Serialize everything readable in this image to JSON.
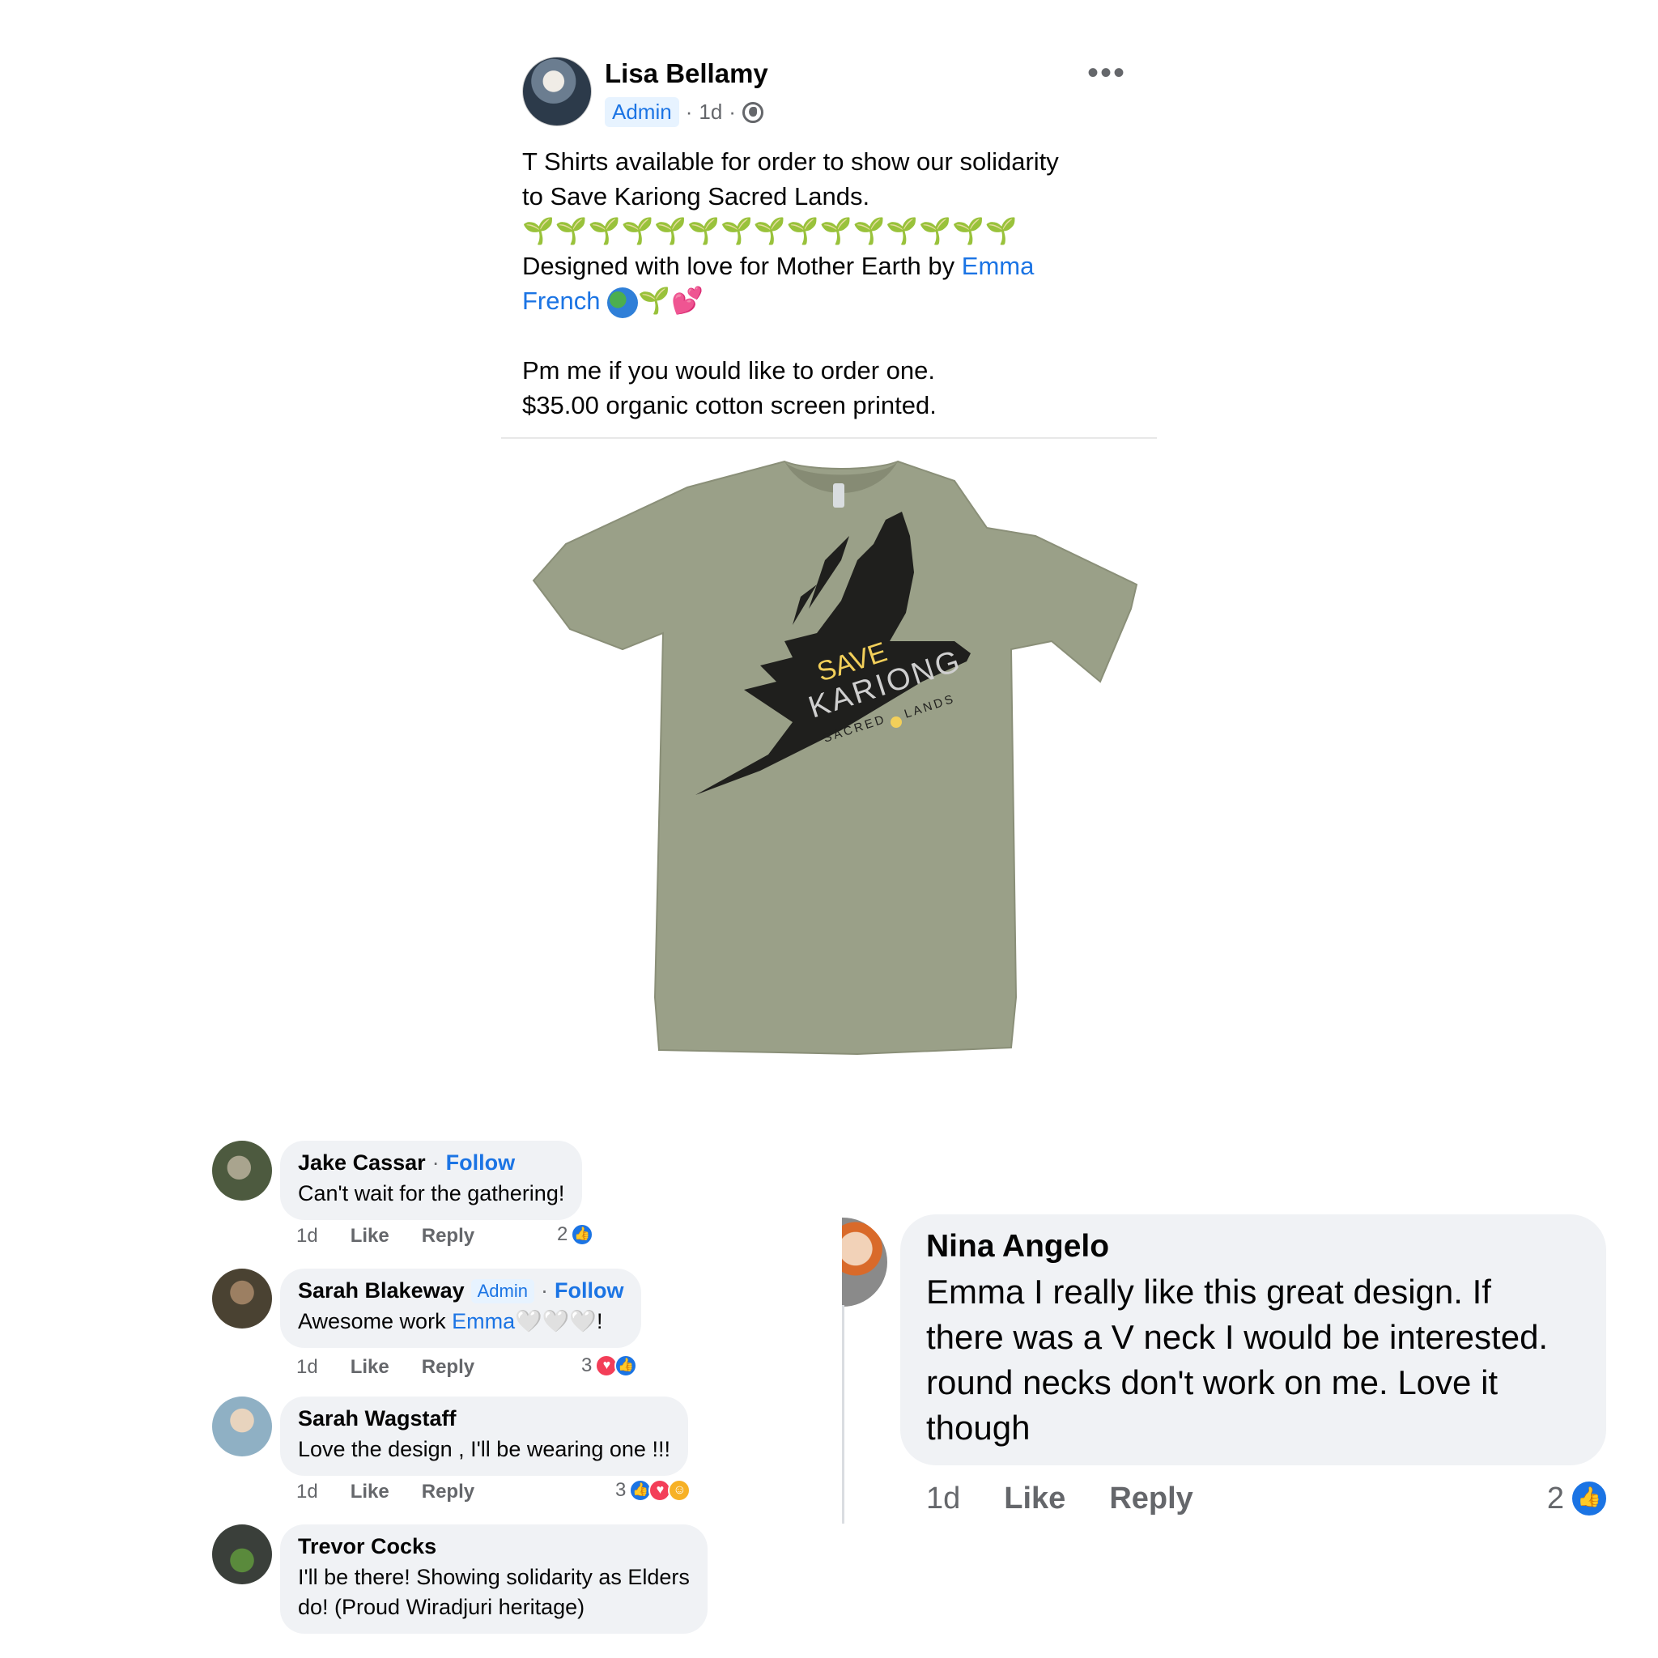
{
  "post": {
    "author": "Lisa Bellamy",
    "badge": "Admin",
    "time": "1d",
    "line1": "T Shirts available for order to show our solidarity",
    "line2": "to Save Kariong Sacred Lands.",
    "sprouts": "🌱🌱🌱🌱🌱🌱🌱🌱🌱🌱🌱🌱🌱🌱🌱",
    "line3_prefix": "Designed with love for Mother Earth by ",
    "line3_link1": "Emma",
    "line4_link2": "French",
    "line5": "Pm me if you would like to order one.",
    "line6": "$35.00 organic cotton screen printed."
  },
  "shirt": {
    "save": "SAVE",
    "kariong": "KARIONG",
    "sacred": "SACRED",
    "lands": "LANDS",
    "shirt_color": "#9aa088",
    "bird_color": "#1f1f1d",
    "accent_color": "#f2cf5a"
  },
  "comments": [
    {
      "name": "Jake Cassar",
      "follow": "Follow",
      "text": "Can't wait for the gathering!",
      "time": "1d",
      "like": "Like",
      "reply": "Reply",
      "count": "2"
    },
    {
      "name": "Sarah Blakeway",
      "badge": "Admin",
      "follow": "Follow",
      "text_prefix": "Awesome work ",
      "text_link": "Emma",
      "text_suffix": "🤍🤍🤍!",
      "time": "1d",
      "like": "Like",
      "reply": "Reply",
      "count": "3"
    },
    {
      "name": "Sarah Wagstaff",
      "text": "Love the design , I'll be wearing one !!!",
      "time": "1d",
      "like": "Like",
      "reply": "Reply",
      "count": "3"
    },
    {
      "name": "Trevor Cocks",
      "text_line1": "I'll be there! Showing solidarity as Elders",
      "text_line2": "do! (Proud Wiradjuri heritage)"
    }
  ],
  "nina": {
    "name": "Nina Angelo",
    "line1": "Emma I really like this great design. If",
    "line2": "there was a V neck I would be interested.",
    "line3": "round necks don't work on me. Love it",
    "line4": "though",
    "time": "1d",
    "like": "Like",
    "reply": "Reply",
    "count": "2"
  },
  "colors": {
    "link": "#1b74e4",
    "meta": "#65676b",
    "bubble": "#f0f2f5",
    "like_blue": "#1b74e4",
    "love_red": "#f33e58"
  },
  "icons": [
    "more-options-icon",
    "globe-icon",
    "thumbs-up-icon",
    "heart-icon",
    "care-icon"
  ]
}
